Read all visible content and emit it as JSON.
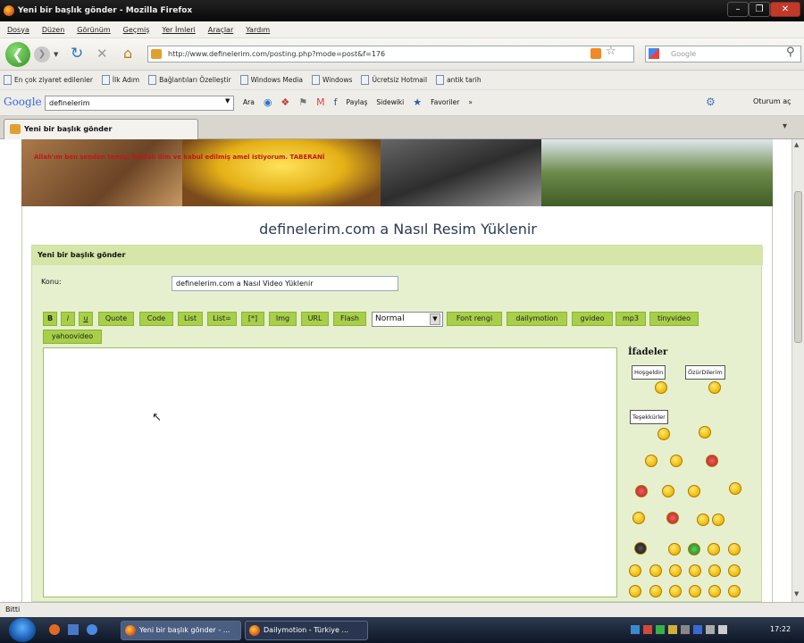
{
  "window": {
    "title": "Yeni bir başlık gönder - Mozilla Firefox"
  },
  "menu": [
    "Dosya",
    "Düzen",
    "Görünüm",
    "Geçmiş",
    "Yer İmleri",
    "Araçlar",
    "Yardım"
  ],
  "nav": {
    "url": "http://www.definelerim.com/posting.php?mode=post&f=176",
    "search_placeholder": "Google"
  },
  "bookmarks": [
    "En çok ziyaret edilenler",
    "İlk Adım",
    "Bağlantıları Özelleştir",
    "Windows Media",
    "Windows",
    "Ücretsiz Hotmail",
    "antik tarih"
  ],
  "googlebar": {
    "logo": "Google",
    "query": "definelerim",
    "ara": "Ara",
    "paylas": "Paylaş",
    "sidewiki": "Sidewiki",
    "favoriler": "Favoriler",
    "oturum": "Oturum aç"
  },
  "tab": {
    "label": "Yeni bir başlık gönder"
  },
  "page": {
    "banner_text": "Allah'ım ben senden temiz; faydalı ilim ve kabul edilmiş amel istiyorum. TABERANİ",
    "title": "definelerim.com a Nasıl Resim Yüklenir",
    "panel_title": "Yeni bir başlık gönder",
    "subject_label": "Konu:",
    "subject_value": "definelerim.com a Nasıl Video Yüklenir",
    "toolbar": [
      "B",
      "i",
      "u",
      "Quote",
      "Code",
      "List",
      "List=",
      "[*]",
      "Img",
      "URL",
      "Flash",
      "Font rengi",
      "dailymotion",
      "gvideo",
      "mp3",
      "tinyvideo",
      "yahoovideo"
    ],
    "font_size": "Normal",
    "smilies_title": "İfadeler",
    "signs": [
      "Hoşgeldin",
      "ÖzürDilerim",
      "Teşekkürler"
    ]
  },
  "status": "Bitti",
  "taskbar": {
    "tasks": [
      "Yeni bir başlık gönder - ...",
      "Dailymotion - Türkiye ..."
    ],
    "clock": "17:22"
  },
  "colors": {
    "toolbar_button": "#a7cf4a",
    "panel_bg": "#e6f0cf",
    "title": "#2b3a55"
  }
}
